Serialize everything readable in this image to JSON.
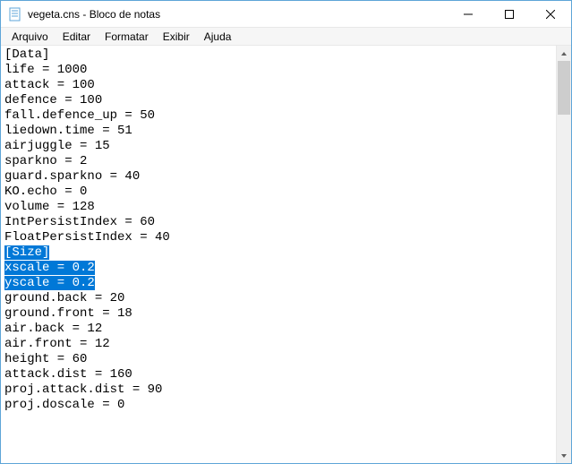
{
  "window": {
    "title": "vegeta.cns - Bloco de notas"
  },
  "menu": {
    "file": "Arquivo",
    "edit": "Editar",
    "format": "Formatar",
    "view": "Exibir",
    "help": "Ajuda"
  },
  "editor": {
    "lines": [
      "[Data]",
      "life = 1000",
      "attack = 100",
      "defence = 100",
      "fall.defence_up = 50",
      "liedown.time = 51",
      "airjuggle = 15",
      "sparkno = 2",
      "guard.sparkno = 40",
      "KO.echo = 0",
      "volume = 128",
      "IntPersistIndex = 60",
      "FloatPersistIndex = 40",
      "",
      "[Size]",
      "xscale = 0.2",
      "yscale = 0.2",
      "ground.back = 20",
      "ground.front = 18",
      "air.back = 12",
      "air.front = 12",
      "height = 60",
      "attack.dist = 160",
      "proj.attack.dist = 90",
      "proj.doscale = 0"
    ],
    "selection_start": 14,
    "selection_end": 16
  }
}
